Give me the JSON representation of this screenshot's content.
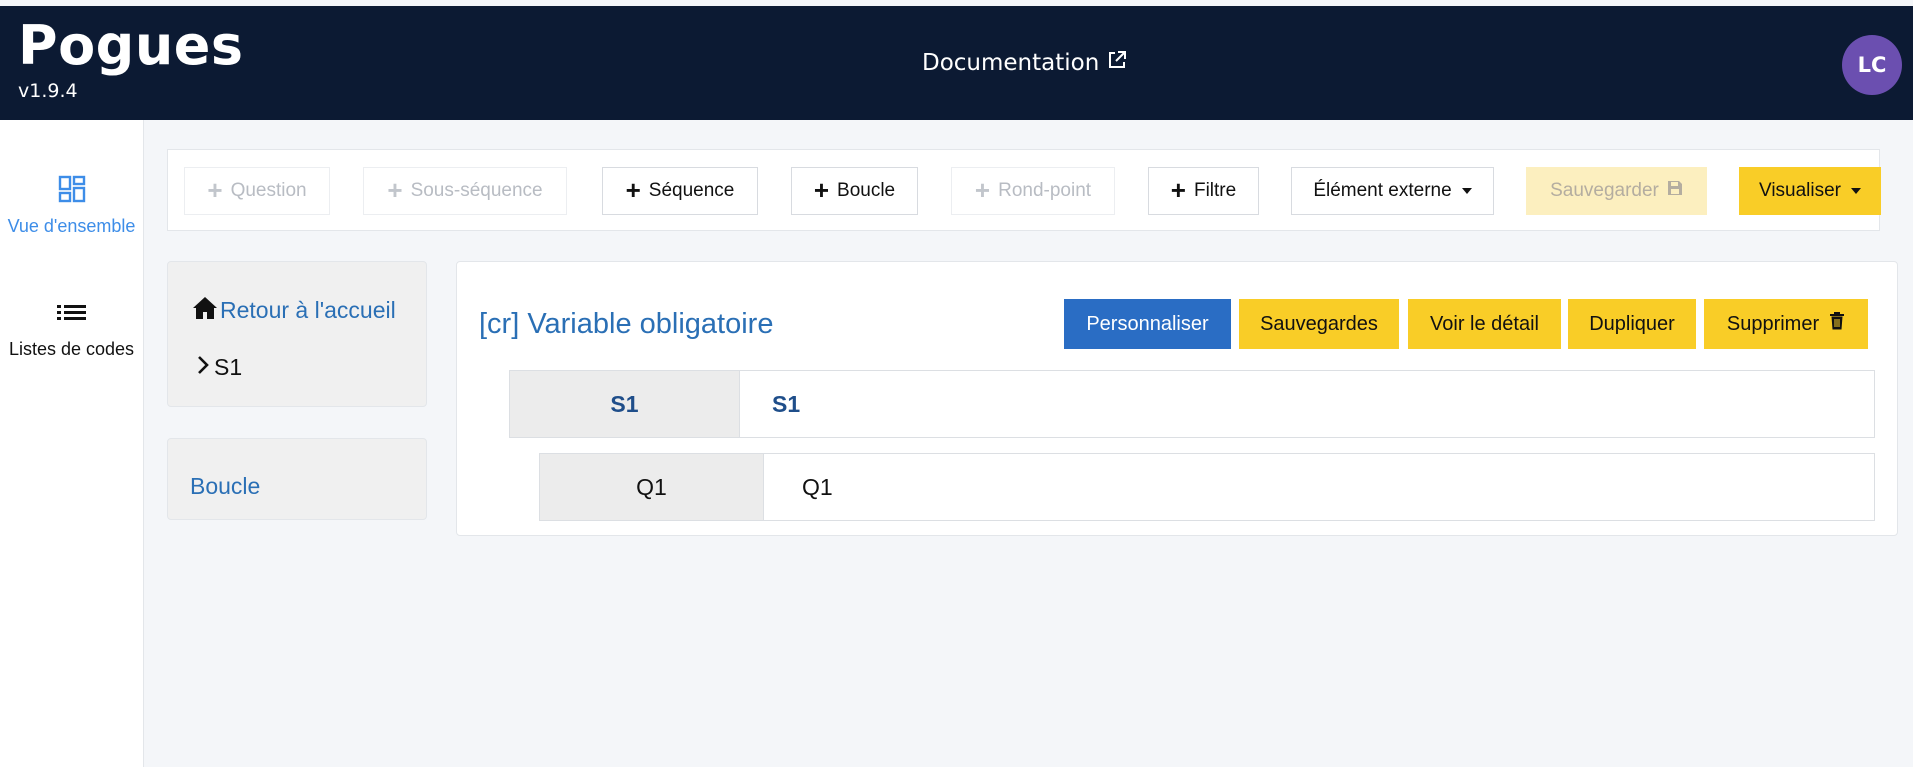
{
  "header": {
    "app_name": "Pogues",
    "version": "v1.9.4",
    "documentation_label": "Documentation",
    "documentation_icon": "external-link-icon",
    "user_initials": "LC",
    "colors": {
      "background": "#0c1a33",
      "avatar": "#6b4fb0"
    }
  },
  "sidebar": {
    "items": [
      {
        "label": "Vue d'ensemble",
        "icon": "dashboard-icon",
        "active": true
      },
      {
        "label": "Listes de codes",
        "icon": "list-icon",
        "active": false
      }
    ]
  },
  "toolbar": {
    "question_label": "Question",
    "subsequence_label": "Sous-séquence",
    "sequence_label": "Séquence",
    "loop_label": "Boucle",
    "roundabout_label": "Rond-point",
    "filter_label": "Filtre",
    "external_label": "Élément externe",
    "save_label": "Sauvegarder",
    "visualize_label": "Visualiser"
  },
  "navigation": {
    "home_label": "Retour à l'accueil",
    "current_sequence": "S1",
    "loop_label": "Boucle"
  },
  "questionnaire": {
    "title": "[cr] Variable obligatoire",
    "actions": {
      "customize": "Personnaliser",
      "backups": "Sauvegardes",
      "details": "Voir le détail",
      "duplicate": "Dupliquer",
      "delete": "Supprimer"
    },
    "elements": [
      {
        "type": "sequence",
        "id": "S1",
        "label": "S1"
      },
      {
        "type": "question",
        "id": "Q1",
        "label": "Q1"
      }
    ]
  },
  "colors": {
    "accent_yellow": "#f9cd27",
    "accent_blue": "#2a6dc4",
    "link_blue": "#2a6fb5"
  }
}
